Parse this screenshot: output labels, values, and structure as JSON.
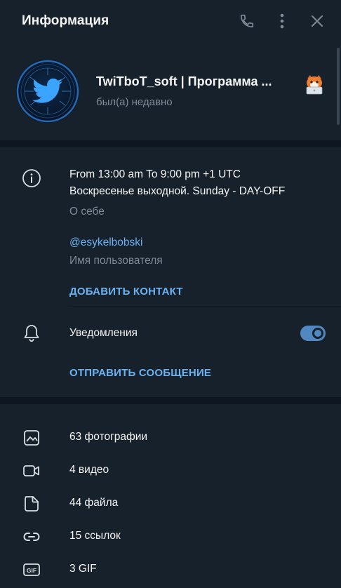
{
  "header": {
    "title": "Информация",
    "icons": [
      "phone-icon",
      "more-vertical-icon",
      "close-icon"
    ]
  },
  "profile": {
    "name": "TwiTboT_soft | Программа ...",
    "status": "был(а) недавно",
    "emoji": "fox-laptop-sticker"
  },
  "info": {
    "bio_line1": "From 13:00 am To 9:00 pm +1 UTC",
    "bio_line2": "Воскресенье выходной. Sunday - DAY-OFF",
    "bio_label": "О себе",
    "username": "@esykelbobski",
    "username_label": "Имя пользователя",
    "add_contact": "ДОБАВИТЬ КОНТАКТ",
    "notifications_label": "Уведомления",
    "notifications_on": true,
    "send_message": "ОТПРАВИТЬ СООБЩЕНИЕ"
  },
  "media": [
    {
      "icon": "photo-icon",
      "label": "63 фотографии"
    },
    {
      "icon": "video-icon",
      "label": "4 видео"
    },
    {
      "icon": "file-icon",
      "label": "44 файла"
    },
    {
      "icon": "link-icon",
      "label": "15 ссылок"
    },
    {
      "icon": "gif-icon",
      "label": "3 GIF"
    }
  ],
  "colors": {
    "background": "#17212b",
    "divider": "#0e1621",
    "accent": "#6ab2f2",
    "toggle": "#5288c1",
    "secondary_text": "#7f8b98"
  }
}
